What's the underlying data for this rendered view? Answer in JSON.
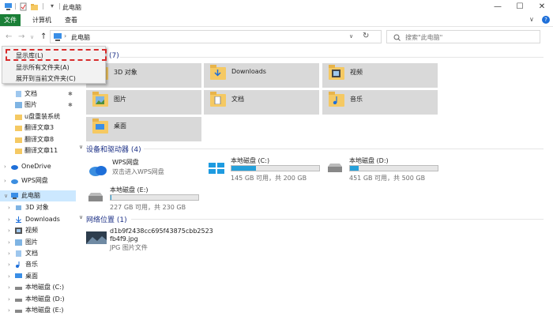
{
  "window": {
    "title": "此电脑",
    "minimize_glyph": "—",
    "maximize_glyph": "☐",
    "close_glyph": "✕",
    "title_sep": "|",
    "qa_dropdown": "▾"
  },
  "ribbon": {
    "tabs": [
      "文件",
      "计算机",
      "查看"
    ],
    "collapse_glyph": "∨",
    "help_glyph": "?"
  },
  "address": {
    "back": "←",
    "forward": "→",
    "recent": "∨",
    "up": "↑",
    "crumb_sep": "›",
    "path": "此电脑",
    "dropdown": "∨",
    "refresh": "↻",
    "search_placeholder": "搜索\"此电脑\""
  },
  "context_menu": {
    "items": [
      "显示库(L)",
      "显示所有文件夹(A)",
      "展开到当前文件夹(C)"
    ]
  },
  "sidebar": {
    "pin_glyph": "✱",
    "items": [
      {
        "label": "文档",
        "pinned": true
      },
      {
        "label": "图片",
        "pinned": true
      },
      {
        "label": "u盘重装系统"
      },
      {
        "label": "翻译文章3"
      },
      {
        "label": "翻译文章8"
      },
      {
        "label": "翻译文章11"
      },
      {
        "label": "OneDrive",
        "arrow": "›"
      },
      {
        "label": "WPS网盘",
        "arrow": "›"
      },
      {
        "label": "此电脑",
        "arrow": "∨",
        "selected": true
      },
      {
        "label": "3D 对象",
        "arrow": "›"
      },
      {
        "label": "Downloads",
        "arrow": "›"
      },
      {
        "label": "视频",
        "arrow": "›"
      },
      {
        "label": "图片",
        "arrow": "›"
      },
      {
        "label": "文档",
        "arrow": "›"
      },
      {
        "label": "音乐",
        "arrow": "›"
      },
      {
        "label": "桌面",
        "arrow": "›"
      },
      {
        "label": "本地磁盘 (C:)",
        "arrow": "›"
      },
      {
        "label": "本地磁盘 (D:)",
        "arrow": "›"
      },
      {
        "label": "本地磁盘 (E:)",
        "arrow": "›"
      }
    ]
  },
  "main": {
    "folders_header_count": "(7)",
    "folders": [
      {
        "label": "3D 对象",
        "sub": "cube"
      },
      {
        "label": "Downloads",
        "sub": "download"
      },
      {
        "label": "视频",
        "sub": "film"
      },
      {
        "label": "图片",
        "sub": "picture"
      },
      {
        "label": "文档",
        "sub": "doc"
      },
      {
        "label": "音乐",
        "sub": "music"
      },
      {
        "label": "桌面",
        "sub": "desktop"
      }
    ],
    "devices_header": "设备和驱动器 (4)",
    "devices": [
      {
        "name": "WPS网盘",
        "sub": "双击进入WPS网盘",
        "bar": false
      },
      {
        "name": "本地磁盘 (C:)",
        "sub": "145 GB 可用，共 200 GB",
        "fill": 0.275,
        "bar": true
      },
      {
        "name": "本地磁盘 (D:)",
        "sub": "451 GB 可用，共 500 GB",
        "fill": 0.098,
        "bar": true
      },
      {
        "name": "本地磁盘 (E:)",
        "sub": "227 GB 可用，共 230 GB",
        "fill": 0.013,
        "bar": true
      }
    ],
    "network_header": "网络位置 (1)",
    "network": [
      {
        "name_line1": "d1b9f2438cc695f43875cbb2523",
        "name_line2": "fb4f9.jpg",
        "sub": "JPG 图片文件"
      }
    ],
    "group_toggle": "∨"
  },
  "colors": {
    "file_tab": "#1a7f37",
    "group_header": "#1e3287",
    "drive_fill": "#26a0da",
    "highlight": "#d72c2c",
    "selected": "#cce8ff"
  }
}
